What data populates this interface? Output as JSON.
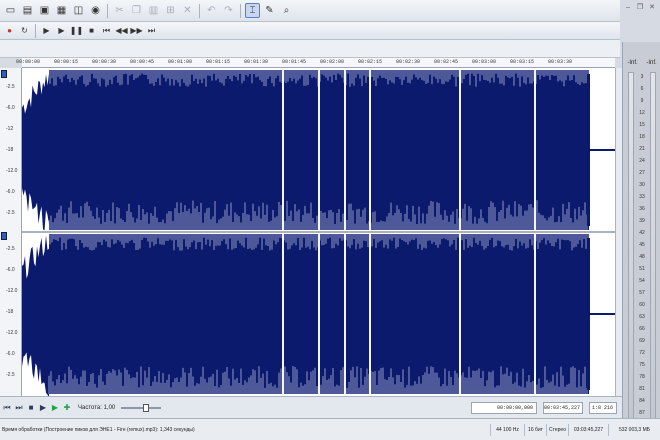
{
  "toolbar": {
    "icons": [
      "new-file-icon",
      "open-folder-icon",
      "save-icon",
      "save-as-icon",
      "render-icon",
      "properties-icon",
      "cut-icon",
      "copy-icon",
      "paste-icon",
      "mix-icon",
      "trim-icon",
      "undo-icon",
      "redo-icon",
      "edit-tool-icon",
      "pencil-tool-icon",
      "zoom-tool-icon"
    ]
  },
  "transport_top": {
    "icons": [
      "record-icon",
      "loop-icon",
      "play-all-icon",
      "play-icon",
      "pause-icon",
      "stop-icon",
      "go-start-icon",
      "rewind-icon",
      "forward-icon",
      "go-end-icon"
    ]
  },
  "ruler": {
    "ticks": [
      "00:00:00",
      "00:00:15",
      "00:00:30",
      "00:00:45",
      "00:01:00",
      "00:01:15",
      "00:01:30",
      "00:01:45",
      "00:02:00",
      "00:02:15",
      "00:02:30",
      "00:02:45",
      "00:03:00",
      "00:03:15",
      "00:03:30"
    ]
  },
  "scale": {
    "top": [
      "-2.5",
      "-6.0",
      "-12",
      "-18",
      "-12.0",
      "-6.0",
      "-2.5"
    ],
    "bottom": [
      "-2.5",
      "-6.0",
      "-12.0",
      "-18",
      "-12.0",
      "-6.0",
      "-2.5"
    ]
  },
  "meters": {
    "header": [
      "-Inf.",
      "-Inf."
    ],
    "labels": [
      "3",
      "6",
      "9",
      "12",
      "15",
      "18",
      "21",
      "24",
      "27",
      "30",
      "33",
      "36",
      "39",
      "42",
      "45",
      "48",
      "51",
      "54",
      "57",
      "60",
      "63",
      "66",
      "69",
      "72",
      "75",
      "78",
      "81",
      "84",
      "87"
    ]
  },
  "playback": {
    "rate_label": "Частота: 1,00",
    "time_position": "00:00:00,000",
    "time_end": "00:03:45,227",
    "zoom_ratio": "1:8 216"
  },
  "status": {
    "text": "Время обработки (Построение пиков для ЭНЕ1 - Fire (remux).mp3): 1,343 секунды)",
    "sample_rate": "44 100 Hz",
    "bit_depth": "16 бит",
    "channels": "Стерео",
    "length": "03:03:45,227",
    "disk_space": "532 003,3 МБ"
  }
}
